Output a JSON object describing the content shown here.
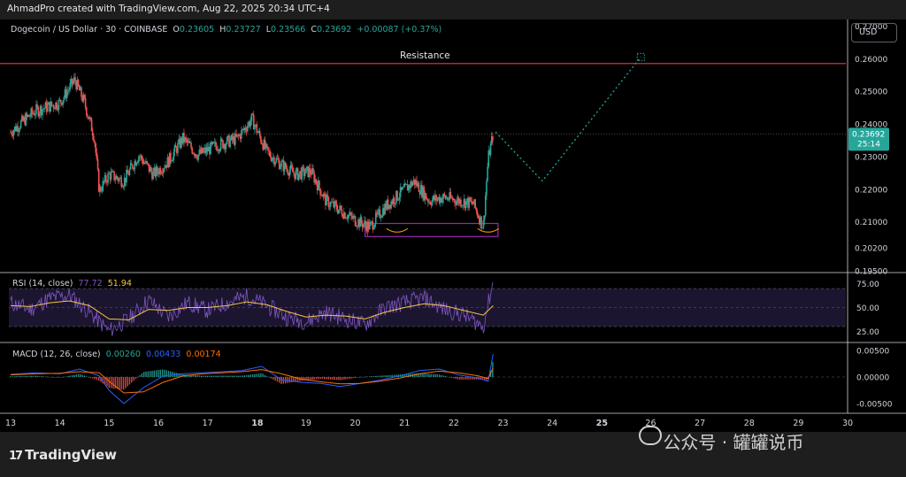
{
  "header": {
    "credit": "AhmadPro created with TradingView.com, Aug 22, 2025 20:34 UTC+4"
  },
  "legend": {
    "title": "Dogecoin / US Dollar · 30 · COINBASE",
    "o_label": "O",
    "o": "0.23605",
    "h_label": "H",
    "h": "0.23727",
    "l_label": "L",
    "l": "0.23566",
    "c_label": "C",
    "c": "0.23692",
    "change": "+0.00087 (+0.37%)"
  },
  "currency_button": "USD",
  "annotation_resistance": "Resistance",
  "last_price": {
    "value": "0.23692",
    "countdown": "25:14"
  },
  "rsi": {
    "label": "RSI (14, close)",
    "rsi_value": "77.72",
    "ma_value": "51.94"
  },
  "macd": {
    "label": "MACD (12, 26, close)",
    "hist": "0.00260",
    "macd": "0.00433",
    "signal": "0.00174"
  },
  "footer": {
    "brand": "TradingView",
    "brand_mark": "17"
  },
  "watermark": "公众号 · 罐罐说币",
  "colors": {
    "up": "#26a69a",
    "down": "#ef5350",
    "resistance": "#f23645",
    "rsi": "#7e57c2",
    "rsi_ma": "#f7c548",
    "macd": "#2962ff",
    "signal": "#ff6d00",
    "zone": "#9c27b0",
    "projection": "#26a69a"
  },
  "chart_data": [
    {
      "type": "line",
      "title": "Dogecoin / US Dollar · 30 · COINBASE",
      "x_ticks": [
        "13",
        "14",
        "15",
        "16",
        "17",
        "18",
        "19",
        "20",
        "21",
        "22",
        "23",
        "24",
        "25",
        "26",
        "27",
        "28",
        "29",
        "30"
      ],
      "y_ticks": [
        "0.27000",
        "0.26000",
        "0.25000",
        "0.24000",
        "0.23000",
        "0.22000",
        "0.21000",
        "0.20200",
        "0.19500"
      ],
      "ylim": [
        0.195,
        0.272
      ],
      "x": [
        13.0,
        13.5,
        14.0,
        14.3,
        14.5,
        14.7,
        14.8,
        15.0,
        15.3,
        15.6,
        15.9,
        16.2,
        16.5,
        16.8,
        17.2,
        17.6,
        17.9,
        18.2,
        18.5,
        18.8,
        19.1,
        19.4,
        19.7,
        20.0,
        20.3,
        20.6,
        20.9,
        21.2,
        21.5,
        21.8,
        22.1,
        22.4,
        22.6,
        22.7,
        22.8
      ],
      "series": [
        {
          "values": [
            0.2375,
            0.244,
            0.2465,
            0.2535,
            0.2465,
            0.236,
            0.2195,
            0.2245,
            0.2225,
            0.2305,
            0.2245,
            0.2285,
            0.2355,
            0.2305,
            0.2335,
            0.2355,
            0.2415,
            0.2315,
            0.2275,
            0.2245,
            0.2255,
            0.2165,
            0.2135,
            0.2105,
            0.2085,
            0.2145,
            0.2185,
            0.2225,
            0.2165,
            0.2175,
            0.2165,
            0.2155,
            0.2085,
            0.2295,
            0.2369
          ]
        }
      ],
      "resistance": 0.2585,
      "projection": {
        "x": [
          22.85,
          23.8,
          25.8
        ],
        "values": [
          0.2375,
          0.2225,
          0.2605
        ]
      },
      "support_zone": {
        "x": [
          20.2,
          22.9
        ],
        "y": [
          0.2055,
          0.2095
        ]
      }
    },
    {
      "type": "line",
      "y_ticks": [
        "75.00",
        "50.00",
        "25.00"
      ],
      "ylim": [
        15,
        85
      ],
      "x": [
        13.0,
        13.4,
        13.8,
        14.2,
        14.6,
        15.0,
        15.4,
        15.8,
        16.2,
        16.6,
        17.0,
        17.4,
        17.8,
        18.2,
        18.6,
        19.0,
        19.4,
        19.8,
        20.2,
        20.6,
        21.0,
        21.4,
        21.8,
        22.2,
        22.6,
        22.8
      ],
      "series": [
        {
          "values": [
            55,
            48,
            60,
            63,
            45,
            25,
            38,
            58,
            40,
            55,
            47,
            55,
            62,
            52,
            40,
            35,
            45,
            38,
            32,
            50,
            55,
            60,
            48,
            42,
            30,
            78
          ]
        },
        {
          "values": [
            52,
            51,
            55,
            57,
            52,
            38,
            37,
            48,
            47,
            50,
            50,
            52,
            56,
            53,
            46,
            40,
            42,
            41,
            38,
            45,
            50,
            54,
            52,
            47,
            42,
            52
          ]
        }
      ]
    },
    {
      "type": "line",
      "y_ticks": [
        "0.00500",
        "0.00000",
        "-0.00500"
      ],
      "ylim": [
        -0.0065,
        0.006
      ],
      "x": [
        13.0,
        13.5,
        14.0,
        14.4,
        14.8,
        15.0,
        15.3,
        15.7,
        16.1,
        16.5,
        16.9,
        17.3,
        17.7,
        18.1,
        18.5,
        18.9,
        19.3,
        19.7,
        20.1,
        20.5,
        20.9,
        21.3,
        21.7,
        22.1,
        22.5,
        22.7,
        22.8
      ],
      "series": [
        {
          "values": [
            0.0005,
            0.0008,
            0.0006,
            0.0015,
            0.0002,
            -0.0025,
            -0.005,
            -0.002,
            0.0002,
            0.0006,
            0.0008,
            0.001,
            0.0012,
            0.002,
            -0.0005,
            -0.001,
            -0.0012,
            -0.0018,
            -0.0012,
            -0.0006,
            0.0002,
            0.0012,
            0.0015,
            0.0004,
            -0.0002,
            -0.0008,
            0.0043
          ]
        },
        {
          "values": [
            0.0004,
            0.0006,
            0.0007,
            0.001,
            0.0008,
            -0.0008,
            -0.003,
            -0.0028,
            -0.001,
            0.0002,
            0.0006,
            0.0008,
            0.001,
            0.0014,
            0.0006,
            -0.0004,
            -0.0009,
            -0.0013,
            -0.0012,
            -0.0008,
            -0.0002,
            0.0006,
            0.0011,
            0.0008,
            0.0002,
            -0.0003,
            0.0017
          ]
        }
      ]
    }
  ]
}
